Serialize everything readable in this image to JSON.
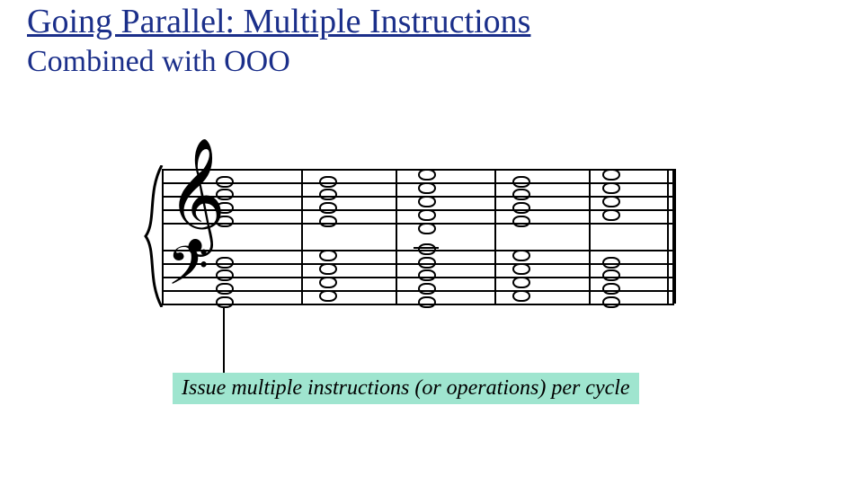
{
  "title": "Going Parallel: Multiple Instructions",
  "subtitle": "Combined with OOO",
  "callout": "Issue multiple instructions (or operations) per cycle",
  "score": {
    "measures": 5,
    "treble_chord_offsets": [
      [
        -22,
        -7,
        8,
        22
      ],
      [
        -22,
        -7,
        8,
        22
      ],
      [
        -30,
        -15,
        0,
        15,
        30
      ],
      [
        -22,
        -7,
        8,
        22
      ],
      [
        -15,
        0,
        15,
        30
      ]
    ],
    "bass_chord_offsets": [
      [
        -22,
        -7,
        8,
        22
      ],
      [
        -15,
        0,
        15,
        30
      ],
      [
        -22,
        -7,
        8,
        22,
        37
      ],
      [
        -15,
        0,
        15,
        30
      ],
      [
        -22,
        -7,
        8,
        22
      ]
    ],
    "barlines_x": [
      0,
      155,
      260,
      370,
      475,
      562,
      568
    ],
    "chord_x": [
      60,
      175,
      285,
      390,
      490
    ]
  }
}
